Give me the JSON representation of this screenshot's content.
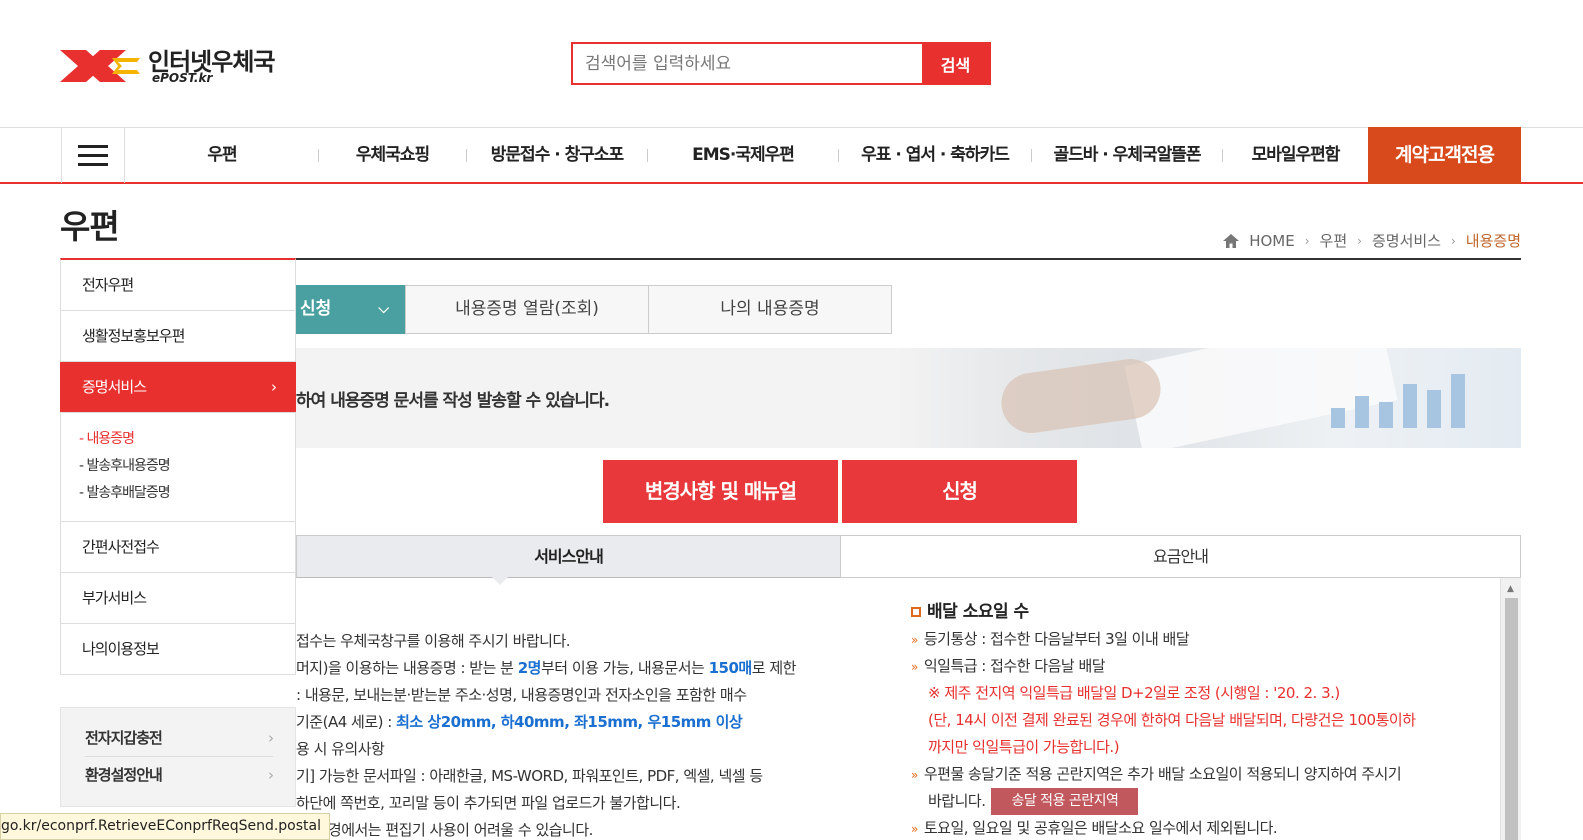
{
  "header": {
    "logo_name": "인터넷우체국",
    "logo_sub": "ePOST.kr",
    "search_placeholder": "검색어를 입력하세요",
    "search_button": "검색"
  },
  "gnb": {
    "items": [
      "우편",
      "우체국쇼핑",
      "방문접수 · 창구소포",
      "EMS·국제우편",
      "우표 · 엽서 · 축하카드",
      "골드바 · 우체국알뜰폰",
      "모바일우편함"
    ],
    "contract": "계약고객전용"
  },
  "page": {
    "title": "우편",
    "breadcrumb": [
      "HOME",
      "우편",
      "증명서비스",
      "내용증명"
    ]
  },
  "lnb": {
    "items": [
      "전자우편",
      "생활정보홍보우편",
      "증명서비스",
      "간편사전접수",
      "부가서비스",
      "나의이용정보"
    ],
    "sub_items": [
      "내용증명",
      "발송후내용증명",
      "발송후배달증명"
    ]
  },
  "quick": [
    "전자지갑충전",
    "환경설정안내"
  ],
  "tabs": {
    "select": "신청",
    "items": [
      "내용증명 열람(조회)",
      "나의 내용증명"
    ]
  },
  "banner_text": "하여 내용증명 문서를 작성 발송할 수 있습니다.",
  "actions": {
    "manual": "변경사항 및 매뉴얼",
    "apply": "신청"
  },
  "service_tabs": [
    "서비스안내",
    "요금안내"
  ],
  "left_lines": [
    {
      "pre": "접수는 우체국창구를 이용해 주시기 바랍니다."
    },
    {
      "pre": "머지)을 이용하는 내용증명 : 받는 분 ",
      "b1": "2명",
      "mid": "부터 이용 가능, 내용문서는 ",
      "b2": "150매",
      "post": "로 제한"
    },
    {
      "pre": ": 내용문, 보내는분·받는분 주소·성명, 내용증명인과 전자소인을 포함한 매수"
    },
    {
      "pre": " 기준(A4 세로) : ",
      "b1": "최소 상20mm, 하40mm, 좌15mm, 우15mm 이상"
    },
    {
      "pre": "용 시 유의사항"
    },
    {
      "pre": "기] 가능한 문서파일 : 아래한글, MS-WORD, 파워포인트, PDF, 엑셀, 넥셀 등"
    },
    {
      "pre": "하단에 쪽번호, 꼬리말 등이 추가되면 파일 업로드가 불가합니다."
    },
    {
      "pre": "E) 환경에서는 편집기 사용이 어려울 수 있습니다."
    }
  ],
  "right": {
    "heading": "배달 소요일 수",
    "rows": [
      "등기통상 : 접수한 다음날부터 3일 이내 배달",
      "익일특급 : 접수한 다음날 배달"
    ],
    "notice": [
      "※ 제주 전지역 익일특급 배달일 D+2일로 조정 (시행일 : '20. 2. 3.)",
      "(단, 14시 이전 결제 완료된 경우에 한하여 다음날 배달되며, 다량건은 100통이하",
      "까지만 익일특급이 가능합니다.)"
    ],
    "remote_1": "우편물 송달기준 적용 곤란지역은 추가 배달 소요일이 적용되니 양지하여 주시기",
    "remote_2": "바랍니다.",
    "remote_button": "송달 적용 곤란지역",
    "last": "토요일, 일요일 및 공휴일은 배달소요 일수에서 제외됩니다."
  },
  "status_url": "go.kr/econprf.RetrieveEConprfReqSend.postal",
  "colors": {
    "brand_red": "#e8302f",
    "contract_orange": "#d84a1b",
    "teal": "#4aa0a0",
    "action_red": "#e8383b"
  }
}
